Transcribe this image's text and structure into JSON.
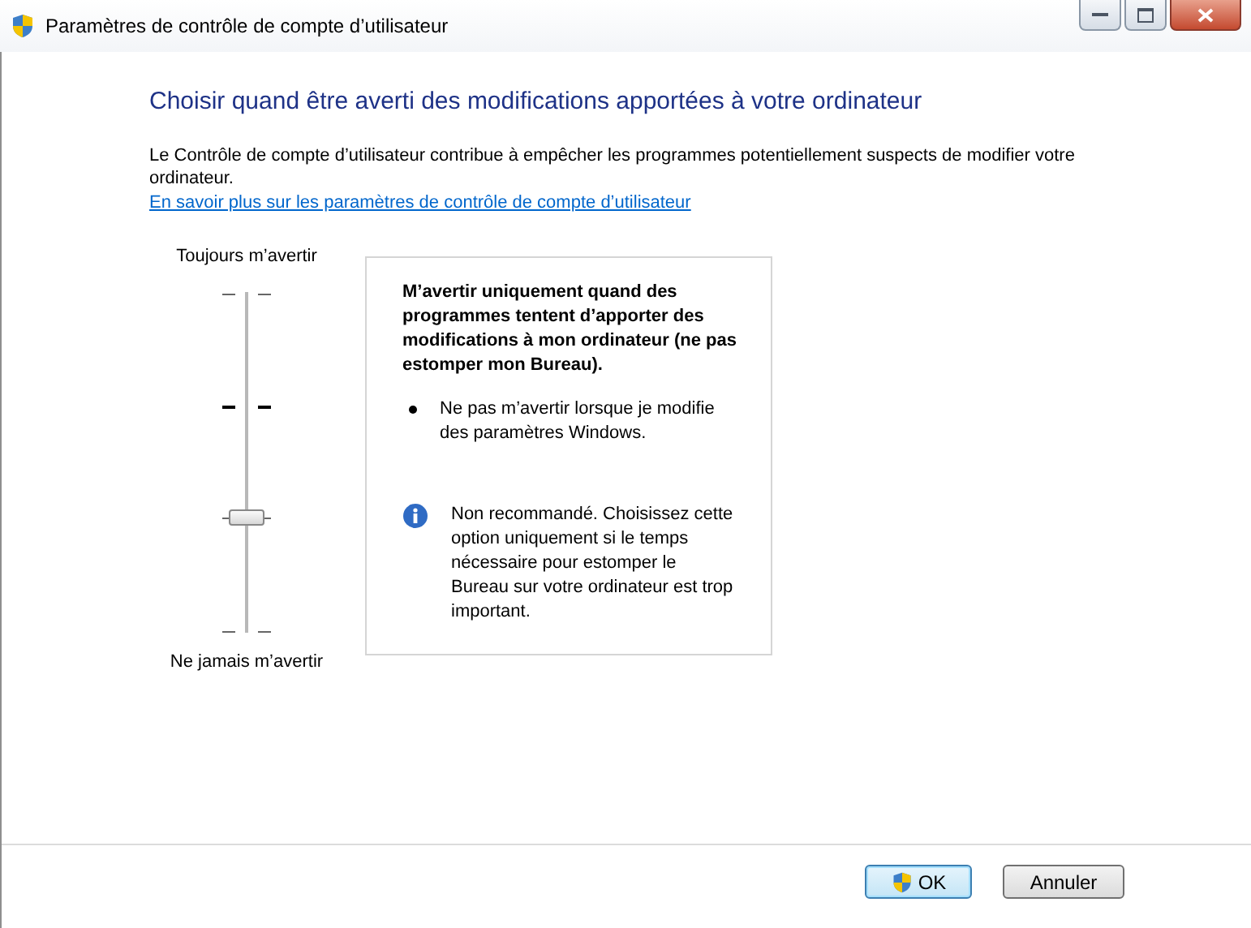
{
  "window": {
    "title": "Paramètres de contrôle de compte d’utilisateur"
  },
  "heading": "Choisir quand être averti des modifications apportées à votre ordinateur",
  "description": "Le Contrôle de compte d’utilisateur contribue à empêcher les programmes potentiellement suspects de modifier votre ordinateur.",
  "link": "En savoir plus sur les paramètres de contrôle de compte d’utilisateur",
  "slider": {
    "top_label": "Toujours m’avertir",
    "bottom_label": "Ne jamais m’avertir",
    "level": 0.333,
    "ticks": [
      {
        "emphasized": false
      },
      {
        "emphasized": true
      },
      {
        "emphasized": false
      },
      {
        "emphasized": false
      }
    ]
  },
  "panel": {
    "title": "M’avertir uniquement quand des programmes tentent d’apporter des modifications à mon ordinateur (ne pas estomper mon Bureau).",
    "bullets": [
      "Ne pas m’avertir lorsque je modifie des paramètres Windows."
    ],
    "note": "Non recommandé. Choisissez cette option uniquement si le temps nécessaire pour estomper le Bureau sur votre ordinateur est trop important."
  },
  "buttons": [
    {
      "label": "OK",
      "kind": "shield"
    },
    {
      "label": "Annuler",
      "kind": "plain"
    }
  ]
}
